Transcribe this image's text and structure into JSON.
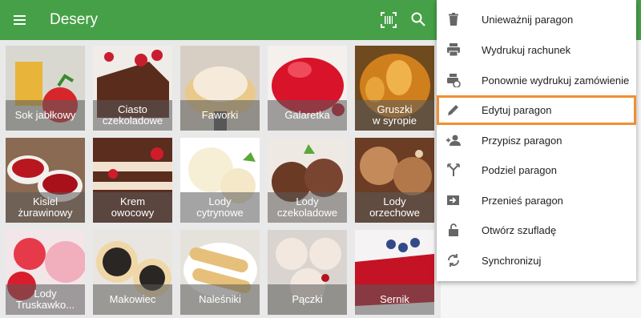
{
  "header": {
    "title": "Desery",
    "menu_icon": "hamburger-menu-icon",
    "barcode_icon": "barcode-scan-icon",
    "search_icon": "search-icon"
  },
  "tiles": [
    {
      "label": "Sok jabłkowy"
    },
    {
      "label": "Ciasto\nczekoladowe"
    },
    {
      "label": "Faworki"
    },
    {
      "label": "Galaretka"
    },
    {
      "label": "Gruszki\nw syropie"
    },
    {
      "label": "Kisiel\nżurawinowy"
    },
    {
      "label": "Krem\nowocowy"
    },
    {
      "label": "Lody\ncytrynowe"
    },
    {
      "label": "Lody\nczekoladowe"
    },
    {
      "label": "Lody\norzechowe"
    },
    {
      "label": "Lody\nTruskawko..."
    },
    {
      "label": "Makowiec"
    },
    {
      "label": "Naleśniki"
    },
    {
      "label": "Pączki"
    },
    {
      "label": "Sernik"
    }
  ],
  "menu": {
    "items": [
      {
        "label": "Unieważnij paragon",
        "icon": "trash-icon"
      },
      {
        "label": "Wydrukuj rachunek",
        "icon": "printer-icon"
      },
      {
        "label": "Ponownie wydrukuj zamówienie",
        "icon": "reprint-icon"
      },
      {
        "label": "Edytuj paragon",
        "icon": "pencil-icon",
        "highlighted": true
      },
      {
        "label": "Przypisz paragon",
        "icon": "assign-person-icon"
      },
      {
        "label": "Podziel paragon",
        "icon": "split-icon"
      },
      {
        "label": "Przenieś paragon",
        "icon": "move-icon"
      },
      {
        "label": "Otwórz szufladę",
        "icon": "unlock-icon"
      },
      {
        "label": "Synchronizuj",
        "icon": "sync-icon"
      }
    ]
  },
  "colors": {
    "appbar": "#46a047",
    "highlight": "#ef8f33"
  }
}
